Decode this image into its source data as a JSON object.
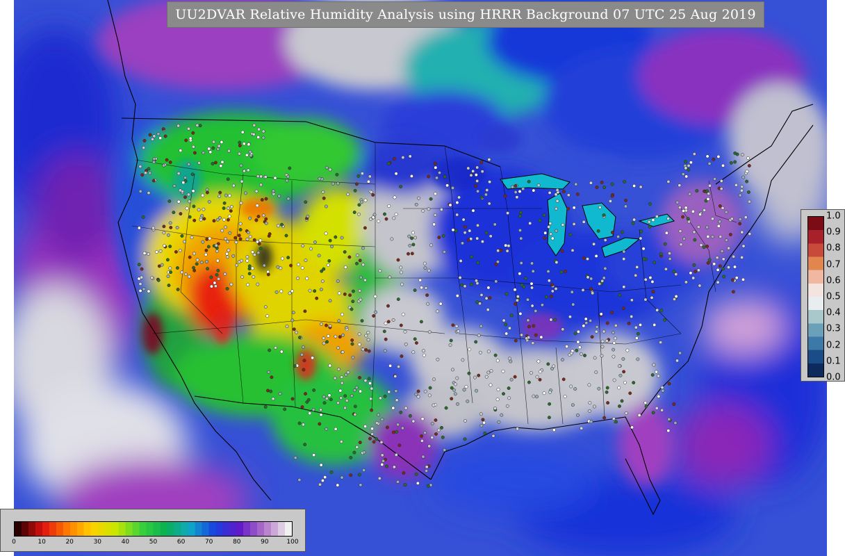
{
  "map": {
    "title": "UU2DVAR Relative Humidity Analysis using HRRR Background 07 UTC 25 Aug 2019",
    "colors": {
      "ocean": "#3b5fd8",
      "deep_blue": "#1b2fd6",
      "purple": "#8b22b8",
      "light_gray": "#c8c8c8",
      "green": "#1ec81e",
      "yellow": "#e8e400",
      "orange": "#f4a000",
      "red": "#e61e1e",
      "cyan": "#12b5d0"
    }
  },
  "rh_colorbar": {
    "ticks": [
      "0",
      "10",
      "20",
      "30",
      "40",
      "50",
      "60",
      "70",
      "80",
      "90",
      "100"
    ],
    "stops": [
      "#2a0000",
      "#e01010",
      "#ff7a00",
      "#ffd000",
      "#c8e600",
      "#3cd23c",
      "#08b050",
      "#10a8c8",
      "#1840e0",
      "#6018c8",
      "#b070c8",
      "#f0f0f0"
    ]
  },
  "increment_colorbar": {
    "ticks": [
      "1.0",
      "0.9",
      "0.8",
      "0.7",
      "0.6",
      "0.5",
      "0.4",
      "0.3",
      "0.2",
      "0.1",
      "0.0"
    ],
    "stops": [
      "#7b0c16",
      "#a8202a",
      "#c84a3a",
      "#e0864e",
      "#f0b8a0",
      "#f4e4e0",
      "#e8eef0",
      "#a8c8cc",
      "#6aa0b8",
      "#3c78a8",
      "#1c4c88",
      "#0c2a5c"
    ]
  }
}
